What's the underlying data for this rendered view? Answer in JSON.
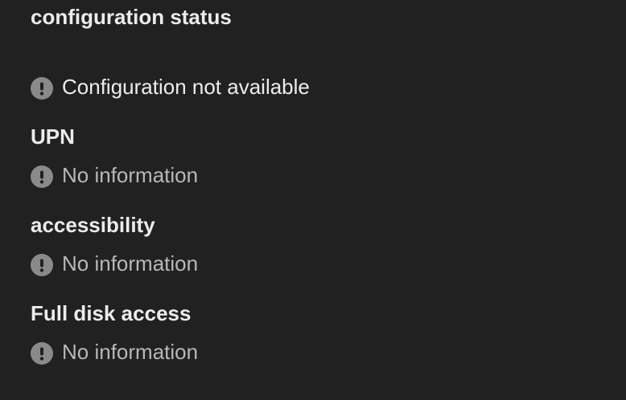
{
  "section": {
    "title": "configuration status",
    "status_icon": "exclamation-circle-icon",
    "configuration": {
      "text": "Configuration not available"
    },
    "items": [
      {
        "label": "UPN",
        "value": "No information"
      },
      {
        "label": "accessibility",
        "value": "No information"
      },
      {
        "label": "Full disk access",
        "value": "No information"
      }
    ]
  },
  "colors": {
    "background": "#212121",
    "text_primary": "#ececec",
    "text_muted": "#b8b8b8",
    "icon_background": "#8a8a8a",
    "icon_glyph": "#212121"
  }
}
